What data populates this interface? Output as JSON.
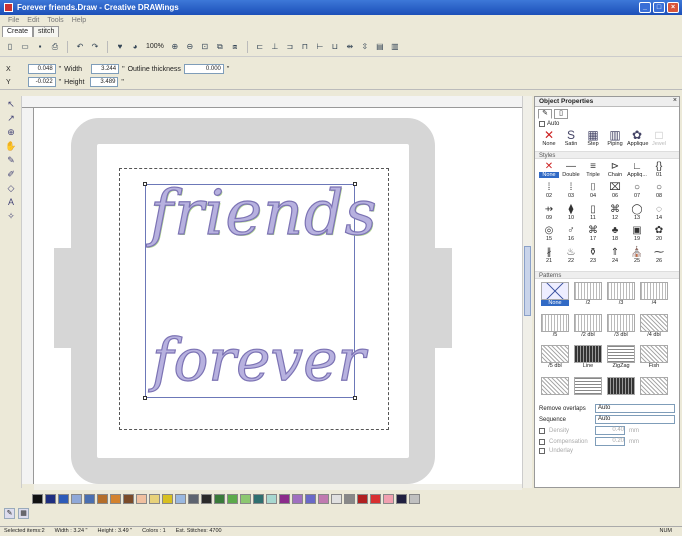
{
  "window": {
    "title": "Forever friends.Draw - Creative DRAWings",
    "buttons": [
      "_",
      "□",
      "×"
    ]
  },
  "menu": [
    "File",
    "Edit",
    "Tools",
    "Help"
  ],
  "tabs": [
    "Create",
    "stitch"
  ],
  "toolbar": {
    "zoom": "100%"
  },
  "props": {
    "x_label": "X",
    "x_value": "0.048",
    "width_label": "Width",
    "width_value": "3.244",
    "outline_label": "Outline thickness",
    "outline_value": "0.000",
    "y_label": "Y",
    "y_value": "-0.022",
    "height_label": "Height",
    "height_value": "3.489",
    "unit": "\""
  },
  "canvas": {
    "word1": "friends",
    "word2": "forever"
  },
  "panel": {
    "title": "Object Properties",
    "auto_label": "Auto",
    "types": [
      {
        "icon": "✕",
        "label": "None"
      },
      {
        "icon": "S",
        "label": "Satin"
      },
      {
        "icon": "▦",
        "label": "Step"
      },
      {
        "icon": "▥",
        "label": "Piping"
      },
      {
        "icon": "✿",
        "label": "Applique"
      },
      {
        "icon": "□",
        "label": "Jewel"
      }
    ],
    "styles_label": "Styles",
    "styles": [
      {
        "icon": "✕",
        "label": "None"
      },
      {
        "icon": "—",
        "label": "Double"
      },
      {
        "icon": "≡",
        "label": "Triple"
      },
      {
        "icon": "⊳",
        "label": "Chain"
      },
      {
        "icon": "∟",
        "label": "Appliq..."
      },
      {
        "icon": "{}",
        "label": "01"
      },
      {
        "icon": "⁞",
        "label": "02"
      },
      {
        "icon": "⁞",
        "label": "03"
      },
      {
        "icon": "⌷",
        "label": "04"
      },
      {
        "icon": "⌧",
        "label": "06"
      },
      {
        "icon": "○",
        "label": "07"
      },
      {
        "icon": "○",
        "label": "08"
      },
      {
        "icon": "⇸",
        "label": "09"
      },
      {
        "icon": "⧫",
        "label": "10"
      },
      {
        "icon": "▯",
        "label": "11"
      },
      {
        "icon": "⌘",
        "label": "12"
      },
      {
        "icon": "◯",
        "label": "13"
      },
      {
        "icon": "◌",
        "label": "14"
      },
      {
        "icon": "◎",
        "label": "15"
      },
      {
        "icon": "♂",
        "label": "16"
      },
      {
        "icon": "⌘",
        "label": "17"
      },
      {
        "icon": "♣",
        "label": "18"
      },
      {
        "icon": "▣",
        "label": "19"
      },
      {
        "icon": "✿",
        "label": "20"
      },
      {
        "icon": "∦",
        "label": "21"
      },
      {
        "icon": "♨",
        "label": "22"
      },
      {
        "icon": "⚱",
        "label": "23"
      },
      {
        "icon": "⇑",
        "label": "24"
      },
      {
        "icon": "⛪",
        "label": "25"
      },
      {
        "icon": "⁓",
        "label": "26"
      }
    ],
    "patterns_label": "Patterns",
    "patterns": [
      {
        "kind": "x",
        "label": "None"
      },
      {
        "kind": "",
        "label": "/2"
      },
      {
        "kind": "",
        "label": "/3"
      },
      {
        "kind": "",
        "label": "/4"
      },
      {
        "kind": "",
        "label": "/5"
      },
      {
        "kind": "",
        "label": "/2 dbl"
      },
      {
        "kind": "",
        "label": "/3 dbl"
      },
      {
        "kind": "diag",
        "label": "/4 dbl"
      },
      {
        "kind": "diag",
        "label": "/5 dbl"
      },
      {
        "kind": "dense",
        "label": "Line"
      },
      {
        "kind": "brick",
        "label": "ZigZag"
      },
      {
        "kind": "diag",
        "label": "Fish"
      },
      {
        "kind": "diag",
        "label": ""
      },
      {
        "kind": "brick",
        "label": ""
      },
      {
        "kind": "dense",
        "label": ""
      },
      {
        "kind": "diag",
        "label": ""
      }
    ],
    "remove_overlaps_label": "Remove overlaps",
    "remove_overlaps_value": "Auto",
    "sequence_label": "Sequence",
    "sequence_value": "Auto",
    "density_label": "Density",
    "density_value": "0.40",
    "density_unit": "mm",
    "compensation_label": "Compensation",
    "compensation_value": "0.20",
    "compensation_unit": "mm",
    "underlay_label": "Underlay"
  },
  "palette": [
    "#111111",
    "#1f2f80",
    "#2d5bb8",
    "#8fa8d8",
    "#4a6fb0",
    "#b46e2a",
    "#d3822e",
    "#7a4b2a",
    "#f0c0a0",
    "#e8d27a",
    "#d8c020",
    "#9ab8e0",
    "#5e6470",
    "#2a2a2a",
    "#3a7a3a",
    "#5caa4a",
    "#8cc870",
    "#2f6f6f",
    "#a8d8d0",
    "#8b2b8b",
    "#a070c0",
    "#6a6ac8",
    "#c07ab0",
    "#e0e0e0",
    "#888888",
    "#b02020",
    "#d83030",
    "#f0a0b0",
    "#202040",
    "#c0c0c0"
  ],
  "status": {
    "selected": "Selected items:2",
    "width": "Width : 3.24 \"",
    "height": "Height : 3.49 \"",
    "colors": "Colors : 1",
    "stitches": "Est. Stitches: 4700",
    "num": "NUM"
  }
}
